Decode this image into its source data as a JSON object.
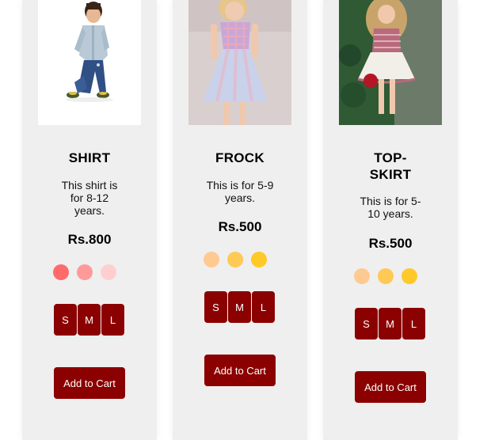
{
  "products": [
    {
      "title": "SHIRT",
      "description": "This shirt is for 8-12 years.",
      "price": "Rs.800",
      "swatch_colors": [
        "#ff6b6b",
        "#ff9a9a",
        "#ffcfcf"
      ],
      "sizes": [
        "S",
        "M",
        "L"
      ],
      "cart_label": "Add to Cart"
    },
    {
      "title": "FROCK",
      "description": "This is for 5-9 years.",
      "price": "Rs.500",
      "swatch_colors": [
        "#ffca91",
        "#ffc955",
        "#ffc928"
      ],
      "sizes": [
        "S",
        "M",
        "L"
      ],
      "cart_label": "Add to Cart"
    },
    {
      "title": "TOP-SKIRT",
      "description": "This is for 5-10 years.",
      "price": "Rs.500",
      "swatch_colors": [
        "#ffca91",
        "#ffc955",
        "#ffc928"
      ],
      "sizes": [
        "S",
        "M",
        "L"
      ],
      "cart_label": "Add to Cart"
    }
  ],
  "colors": {
    "card_background": "#efefef",
    "button_background": "#8b0000",
    "button_text": "#ffffff"
  }
}
